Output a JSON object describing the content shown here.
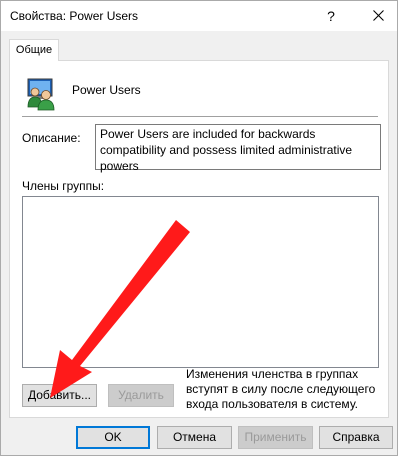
{
  "window": {
    "title": "Свойства: Power Users",
    "help_glyph": "?",
    "close_glyph": "✕"
  },
  "tabs": [
    {
      "label": "Общие"
    }
  ],
  "general": {
    "group_icon": "users-group-icon",
    "group_name": "Power Users",
    "description_label": "Описание:",
    "description_value": "Power Users are included for backwards compatibility and possess limited administrative powers",
    "members_label": "Члены группы:",
    "members": [],
    "add_button": "Добавить...",
    "remove_button": "Удалить",
    "membership_note": "Изменения членства в группах вступят в силу после следующего входа пользователя в систему."
  },
  "footer": {
    "ok": "OK",
    "cancel": "Отмена",
    "apply": "Применить",
    "help": "Справка"
  },
  "annotation": {
    "arrow_color": "#ff1a1a",
    "target": "add-button"
  }
}
